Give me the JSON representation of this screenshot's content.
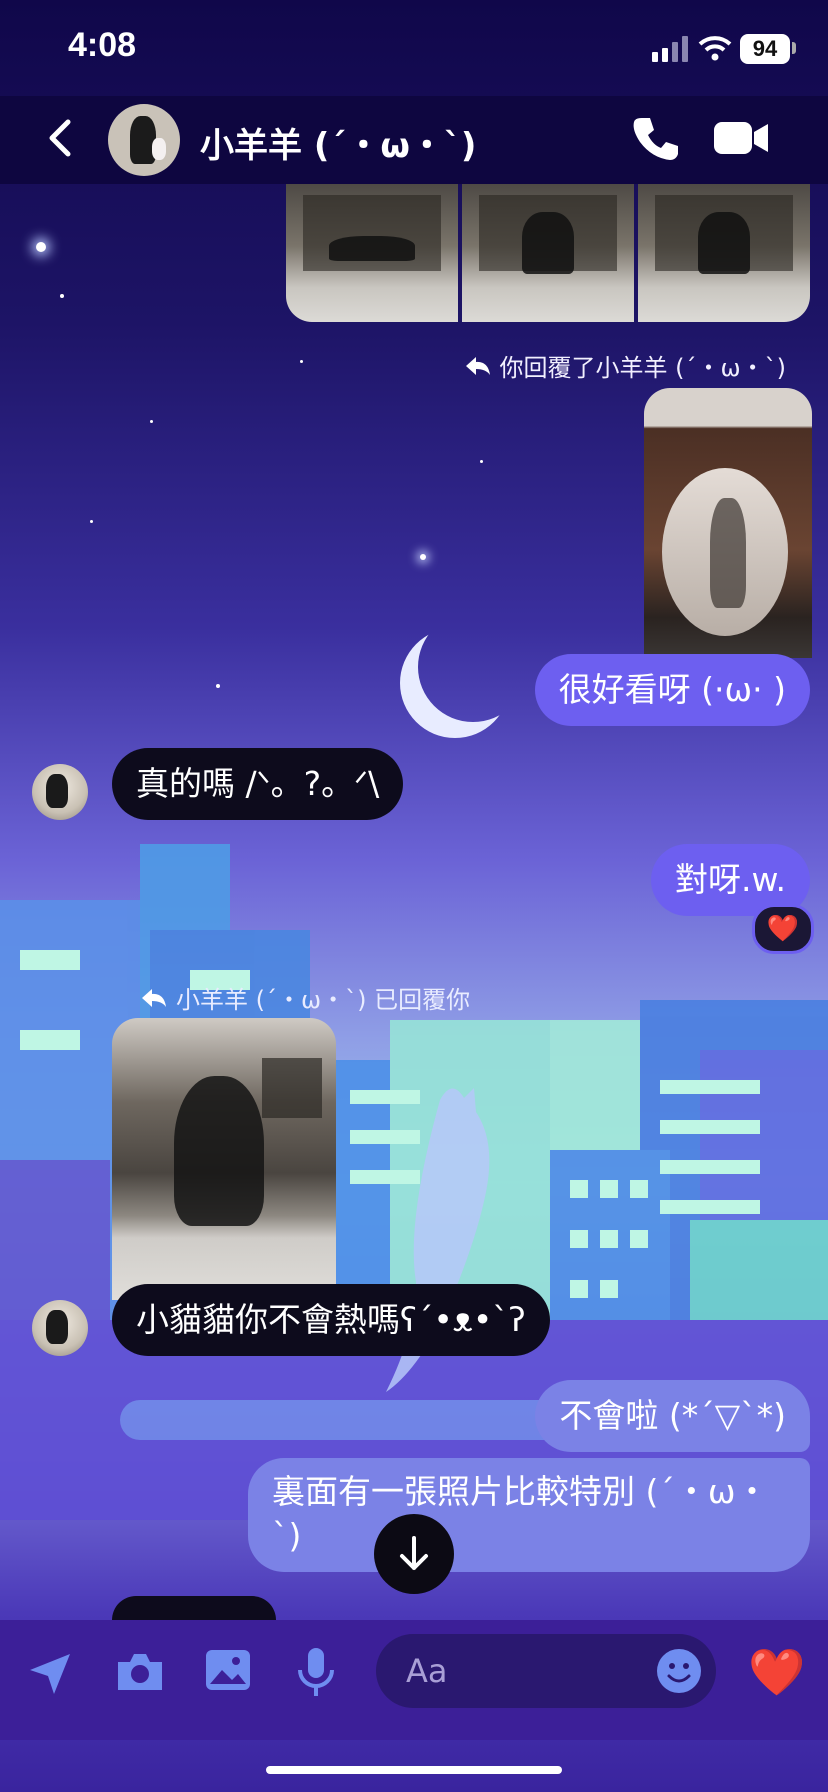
{
  "status_bar": {
    "time": "4:08",
    "battery": "94"
  },
  "header": {
    "contact_name": "小羊羊 (ˊ・ω・ˋ)"
  },
  "messages": {
    "reply_note_out": "你回覆了小羊羊 (ˊ・ω・ˋ)",
    "msg_out_1": "很好看呀 (·ω· )",
    "msg_in_1": "真的嗎 /ᐠ。?。ᐟ\\",
    "msg_out_2": "對呀.w.",
    "reaction_emoji": "❤️",
    "reply_note_in": "小羊羊 (ˊ・ω・ˋ) 已回覆你",
    "msg_in_2": "小貓貓你不會熱嗎ʕ´•ᴥ•`ʔ",
    "msg_out_3": "不會啦 (*ˊ▽ˋ*)",
    "msg_out_4_line1": "裏面有一張照片比較特別 (ˊ・ω・",
    "msg_out_4_line2": "ˋ)"
  },
  "composer": {
    "placeholder": "Aa",
    "like_emoji": "❤️"
  },
  "colors": {
    "accent": "#6d5ff0",
    "incoming_bubble": "#0d0b1c",
    "header_bg": "#0e0640",
    "composer_bg": "#3c1f98"
  },
  "icons": [
    "back-chevron-icon",
    "phone-icon",
    "video-camera-icon",
    "reply-arrow-icon",
    "heart-icon",
    "arrow-down-icon",
    "location-arrow-icon",
    "camera-icon",
    "image-icon",
    "microphone-icon",
    "smiley-icon"
  ]
}
